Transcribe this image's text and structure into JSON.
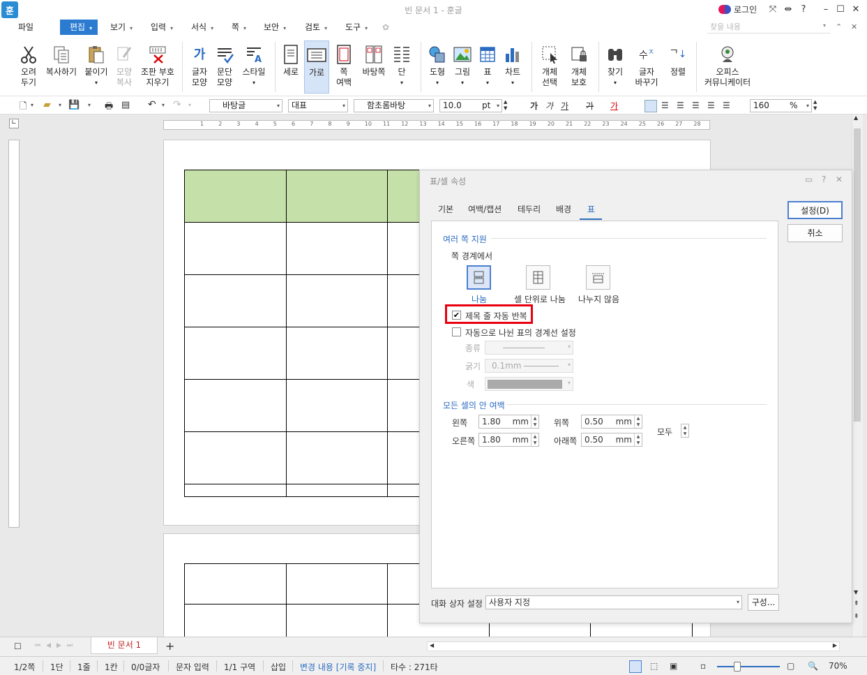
{
  "window": {
    "title": "빈 문서 1 - 훈글",
    "app_icon": "훈",
    "login": "로그인",
    "help": "?"
  },
  "menu": {
    "items": [
      {
        "label": "파일",
        "dd": ""
      },
      {
        "label": "편집",
        "dd": "▾"
      },
      {
        "label": "보기",
        "dd": "▾"
      },
      {
        "label": "입력",
        "dd": "▾"
      },
      {
        "label": "서식",
        "dd": "▾"
      },
      {
        "label": "쪽",
        "dd": "▾"
      },
      {
        "label": "보안",
        "dd": "▾"
      },
      {
        "label": "검토",
        "dd": "▾"
      },
      {
        "label": "도구",
        "dd": "▾"
      }
    ],
    "search_placeholder": "찾을 내용"
  },
  "ribbon": {
    "cut": "오려\n두기",
    "copy": "복사하기",
    "paste": "붙이기",
    "format_copy": "모양\n복사",
    "clear_marks": "조판 부호\n지우기",
    "char_shape": "글자\n모양",
    "para_shape": "문단\n모양",
    "style": "스타일",
    "portrait": "세로",
    "landscape": "가로",
    "page_margin": "쪽\n여백",
    "page_bg": "바탕쪽",
    "columns": "단",
    "shape": "도형",
    "picture": "그림",
    "table": "표",
    "chart": "차트",
    "obj_select": "개체\n선택",
    "obj_protect": "개체\n보호",
    "find": "찾기",
    "replace": "글자\n바꾸기",
    "sort": "정렬",
    "office_community": "오피스\n커뮤니케이터"
  },
  "toolbar": {
    "style_combo": "바탕글",
    "lang_combo": "대표",
    "font_combo": "함초롬바탕",
    "size": "10.0",
    "size_unit": "pt",
    "zoom": "160",
    "zoom_unit": "%",
    "font_glyph": "가"
  },
  "ruler": {
    "marks": [
      "1",
      "2",
      "3",
      "4",
      "5",
      "6",
      "7",
      "8",
      "9",
      "10",
      "11",
      "12",
      "13",
      "14",
      "15",
      "16",
      "17",
      "18",
      "19",
      "20",
      "21",
      "22",
      "23",
      "24",
      "25",
      "26",
      "27",
      "28"
    ]
  },
  "dialog": {
    "title": "표/셀 속성",
    "tabs": [
      "기본",
      "여백/캡션",
      "테두리",
      "배경",
      "표"
    ],
    "active_tab": "표",
    "ok": "설정(D)",
    "cancel": "취소",
    "section_multi_page": "여러 쪽 지원",
    "page_boundary": "쪽 경계에서",
    "split_options": [
      "나눔",
      "셀 단위로 나눔",
      "나누지 않음"
    ],
    "repeat_header": "제목 줄 자동 반복",
    "repeat_header_checked": "✔",
    "auto_border": "자동으로 나뉜 표의 경계선 설정",
    "type_label": "종류",
    "thickness_label": "굵기",
    "thickness_value": "0.1mm",
    "color_label": "색",
    "section_cell_margin": "모든 셀의 안 여백",
    "left_label": "왼쪽",
    "left_value": "1.80",
    "right_label": "오른쪽",
    "right_value": "1.80",
    "top_label": "위쪽",
    "top_value": "0.50",
    "bottom_label": "아래쪽",
    "bottom_value": "0.50",
    "unit": "mm",
    "all_label": "모두",
    "dialog_setting_label": "대화 상자 설정",
    "dialog_setting_value": "사용자 지정",
    "config_btn": "구성..."
  },
  "tabs": {
    "doc_tab": "빈 문서 1",
    "add": "+"
  },
  "status": {
    "page": "1/2쪽",
    "column": "1단",
    "line": "1줄",
    "col": "1칸",
    "chars": "0/0글자",
    "input_mode": "문자 입력",
    "section": "1/1 구역",
    "insert": "삽입",
    "track": "변경 내용 [기록 중지]",
    "keystrokes": "타수 : 271타",
    "zoom": "70%"
  },
  "colors": {
    "accent": "#2b7bd0",
    "header_cell": "#c5e0a8",
    "highlight": "#e8000f"
  }
}
